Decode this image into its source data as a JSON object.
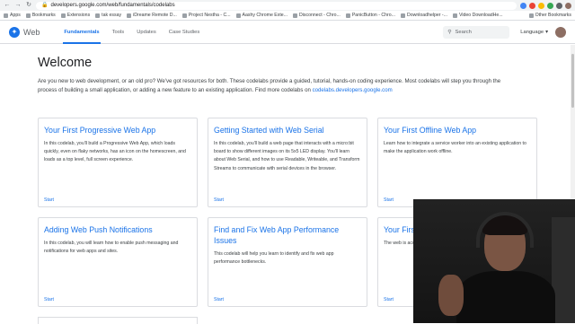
{
  "browser": {
    "url": "developers.google.com/web/fundamentals/codelabs",
    "bookmarks": [
      "Apps",
      "Bookmarks",
      "Extensions",
      "tak essay",
      "iDreame Remote D...",
      "Project Nestha - C...",
      "Aashy Chrome Exte...",
      "Disconnect - Chro...",
      "PanicButton - Chro...",
      "Downloadhelper -...",
      "Video DownloadHe..."
    ],
    "other_bookmarks": "Other Bookmarks"
  },
  "header": {
    "logo": "Web",
    "tabs": [
      "Fundamentals",
      "Tools",
      "Updates",
      "Case Studies"
    ],
    "search_placeholder": "Search",
    "language": "Language"
  },
  "page": {
    "title": "Welcome",
    "intro": "Are you new to web development, or an old pro? We've got resources for both. These codelabs provide a guided, tutorial, hands-on coding experience. Most codelabs will step you through the process of building a small application, or adding a new feature to an existing application. Find more codelabs on ",
    "intro_link": "codelabs.developers.google.com"
  },
  "cards": [
    {
      "title": "Your First Progressive Web App",
      "desc": "In this codelab, you'll build a Progressive Web App, which loads quickly, even on flaky networks, has an icon on the homescreen, and loads as a top level, full screen experience.",
      "cta": "Start"
    },
    {
      "title": "Getting Started with Web Serial",
      "desc": "In this codelab, you'll build a web page that interacts with a micro:bit board to show different images on its 5x5 LED display. You'll learn about Web Serial, and how to use Readable, Writeable, and Transform Streams to communicate with serial devices in the browser.",
      "cta": "Start"
    },
    {
      "title": "Your First Offline Web App",
      "desc": "Learn how to integrate a service worker into an existing application to make the application work offline.",
      "cta": "Start"
    },
    {
      "title": "Adding Web Push Notifications",
      "desc": "In this codelab, you will learn how to enable push messaging and notifications for web apps and sites.",
      "cta": "Start"
    },
    {
      "title": "Find and Fix Web App Performance Issues",
      "desc": "This codelab will help you learn to identify and fix web app performance bottlenecks.",
      "cta": "Start"
    },
    {
      "title": "Your First",
      "desc": "The web is acc small-screen presents its ov developer, you devices.",
      "cta": "Start"
    }
  ],
  "icons": {
    "search": "search-icon",
    "chevron": "chevron-down-icon",
    "lock": "lock-icon",
    "logo": "web-logo-icon"
  },
  "colors": {
    "accent": "#1a73e8",
    "text": "#202124"
  }
}
